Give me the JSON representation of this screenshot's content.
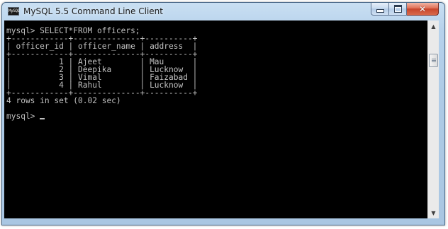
{
  "window": {
    "title": "MySQL 5.5 Command Line Client",
    "icon_label": "MySQL",
    "controls": {
      "minimize": "minimize-icon",
      "maximize": "maximize-icon",
      "close": "close-icon"
    }
  },
  "console": {
    "line1": "mysql> SELECT*FROM officers;",
    "line2": "+------------+--------------+----------+",
    "line3": "| officer_id | officer_name | address  |",
    "line4": "+------------+--------------+----------+",
    "line5": "|          1 | Ajeet        | Mau      |",
    "line6": "|          2 | Deepika      | Lucknow  |",
    "line7": "|          3 | Vimal        | Faizabad |",
    "line8": "|          4 | Rahul        | Lucknow  |",
    "line9": "+------------+--------------+----------+",
    "line10": "4 rows in set (0.02 sec)",
    "line11": "",
    "line12": "mysql> "
  },
  "scrollbar": {
    "up_arrow": "▲",
    "down_arrow": "▼"
  },
  "colors": {
    "console_bg": "#000000",
    "console_fg": "#c0c0c0",
    "close_button": "#c7452b"
  }
}
